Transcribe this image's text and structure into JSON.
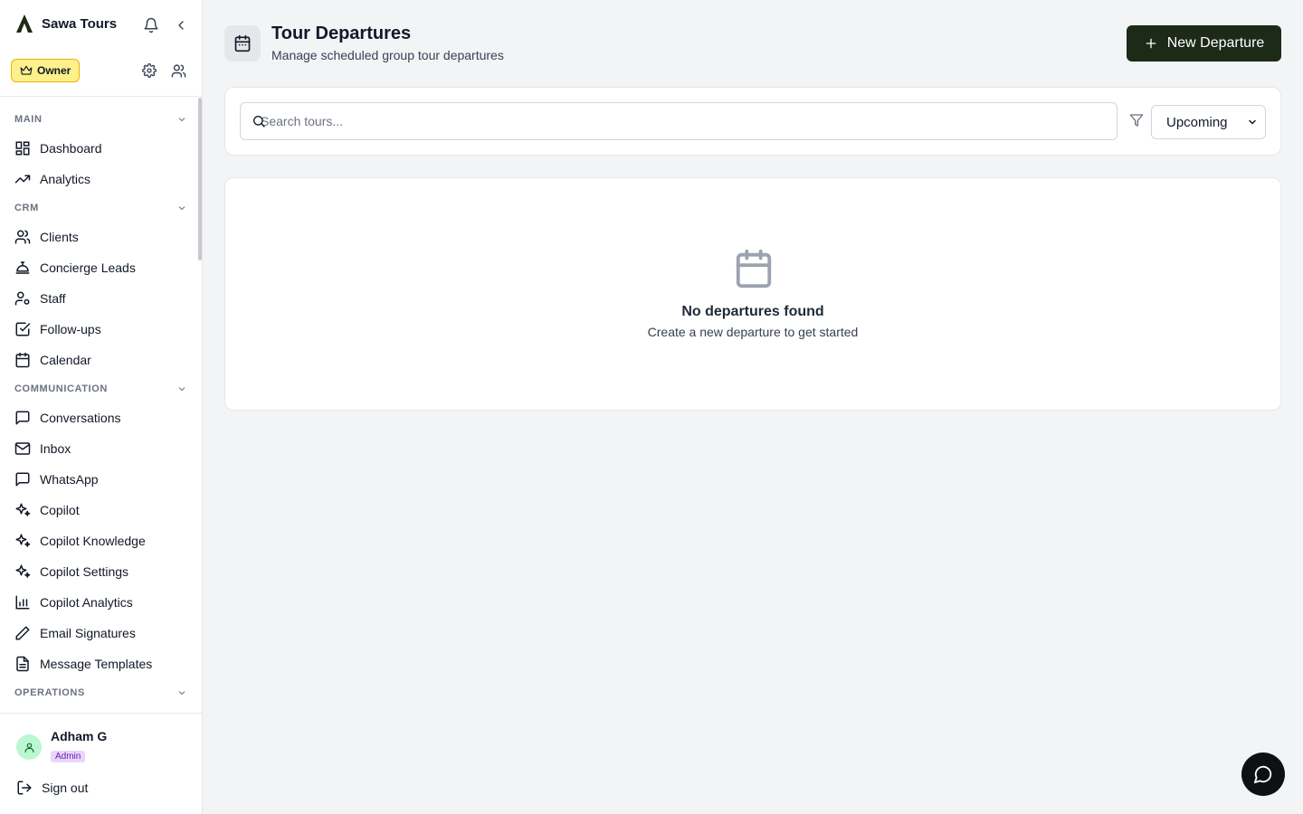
{
  "app": {
    "name": "Sawa Tours",
    "role_badge": "Owner"
  },
  "icons": {
    "brand": "sawa-logo-icon",
    "notifications": "bell-icon",
    "collapse": "chevron-left-icon",
    "settings": "gear-icon",
    "team": "users-icon",
    "search": "search-icon",
    "filter": "filter-icon",
    "chat": "message-circle-icon"
  },
  "sidebar": {
    "sections": [
      {
        "label": "MAIN",
        "items": [
          {
            "label": "Dashboard",
            "icon": "layout-grid-icon"
          },
          {
            "label": "Analytics",
            "icon": "trending-up-icon"
          }
        ]
      },
      {
        "label": "CRM",
        "items": [
          {
            "label": "Clients",
            "icon": "users-icon"
          },
          {
            "label": "Concierge Leads",
            "icon": "concierge-bell-icon"
          },
          {
            "label": "Staff",
            "icon": "user-cog-icon"
          },
          {
            "label": "Follow-ups",
            "icon": "check-square-icon"
          },
          {
            "label": "Calendar",
            "icon": "calendar-icon"
          }
        ]
      },
      {
        "label": "COMMUNICATION",
        "items": [
          {
            "label": "Conversations",
            "icon": "message-square-icon"
          },
          {
            "label": "Inbox",
            "icon": "mail-icon"
          },
          {
            "label": "WhatsApp",
            "icon": "message-square-icon"
          },
          {
            "label": "Copilot",
            "icon": "sparkles-icon"
          },
          {
            "label": "Copilot Knowledge",
            "icon": "sparkles-icon"
          },
          {
            "label": "Copilot Settings",
            "icon": "sparkles-icon"
          },
          {
            "label": "Copilot Analytics",
            "icon": "bar-chart-icon"
          },
          {
            "label": "Email Signatures",
            "icon": "pen-icon"
          },
          {
            "label": "Message Templates",
            "icon": "file-text-icon"
          }
        ]
      },
      {
        "label": "OPERATIONS",
        "items": []
      }
    ]
  },
  "user": {
    "name": "Adham G",
    "role": "Admin",
    "sign_out": "Sign out"
  },
  "header": {
    "title": "Tour Departures",
    "subtitle": "Manage scheduled group tour departures",
    "new_button": "New Departure"
  },
  "filters": {
    "search_placeholder": "Search tours...",
    "status_options": [
      "Upcoming"
    ],
    "status_selected": "Upcoming"
  },
  "empty_state": {
    "title": "No departures found",
    "subtitle": "Create a new departure to get started"
  },
  "colors": {
    "primary_button": "#1c2a17",
    "owner_badge": "#fef08a",
    "admin_badge": "#e9d5ff",
    "avatar": "#bbf7d0"
  }
}
